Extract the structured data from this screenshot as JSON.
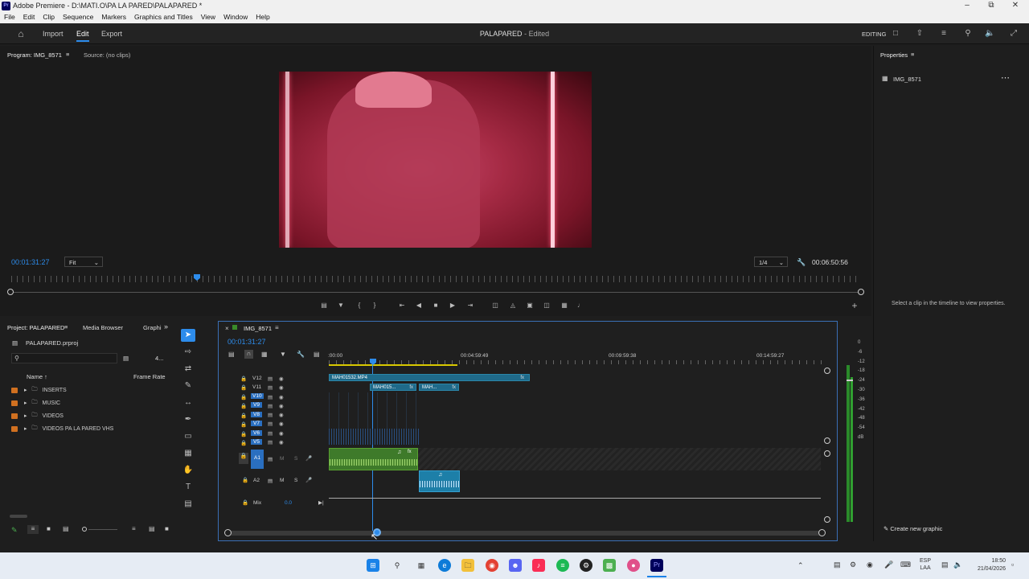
{
  "window": {
    "title": "Adobe Premiere - D:\\MATI.O\\PA LA PARED\\PALAPARED *",
    "logo_text": "Pr"
  },
  "menu": [
    "File",
    "Edit",
    "Clip",
    "Sequence",
    "Markers",
    "Graphics and Titles",
    "View",
    "Window",
    "Help"
  ],
  "header": {
    "nav": [
      "Import",
      "Edit",
      "Export"
    ],
    "active_nav": "Edit",
    "doc_title": "PALAPARED",
    "doc_status": "- Edited",
    "workspace": "EDITING"
  },
  "program": {
    "tab_program": "Program: IMG_8571",
    "tab_source": "Source: (no clips)",
    "timecode": "00:01:31:27",
    "fit": "Fit",
    "resolution": "1/4",
    "duration": "00:06:50:56",
    "playhead_fraction": 0.22
  },
  "properties": {
    "tab": "Properties",
    "item": "IMG_8571",
    "empty_msg": "Select a clip in the timeline to view properties.",
    "create_graphic": "Create new graphic"
  },
  "project": {
    "tab_project": "Project: PALAPARED",
    "tab_media": "Media Browser",
    "tab_graph": "Graphi",
    "file": "PALAPARED.prproj",
    "count": "4...",
    "col_name": "Name",
    "col_rate": "Frame Rate",
    "folders": [
      "INSERTS",
      "MUSIC",
      "VIDEOS",
      "VIDEOS PA LA PARED VHS"
    ]
  },
  "timeline": {
    "tab": "IMG_8571",
    "timecode": "00:01:31:27",
    "ruler": [
      ":00:00",
      "00:04:59:49",
      "00:09:59:38",
      "00:14:59:27"
    ],
    "video_tracks": [
      "V12",
      "V11",
      "V10",
      "V9",
      "V8",
      "V7",
      "V6",
      "V5"
    ],
    "audio_tracks": [
      "A1",
      "A2"
    ],
    "mix_label": "Mix",
    "mix_value": "0.0",
    "clip_v12": "MAH01532.MP4",
    "clip_v11a": "MAH015...",
    "clip_v11b": "MAH...",
    "fx": "fx",
    "m": "M",
    "s": "S",
    "meter_ticks": [
      "0",
      "-6",
      "-12",
      "-18",
      "-24",
      "-30",
      "-36",
      "-42",
      "-48",
      "-54",
      "dB"
    ]
  },
  "taskbar": {
    "lang1": "ESP",
    "lang2": "LAA",
    "time": "18:50",
    "date": "21/04/2026"
  },
  "colors": {
    "accent": "#2d8ceb",
    "clip_video": "#1f6a8a",
    "clip_audio": "#3e7a2a",
    "folder": "#d07020"
  }
}
